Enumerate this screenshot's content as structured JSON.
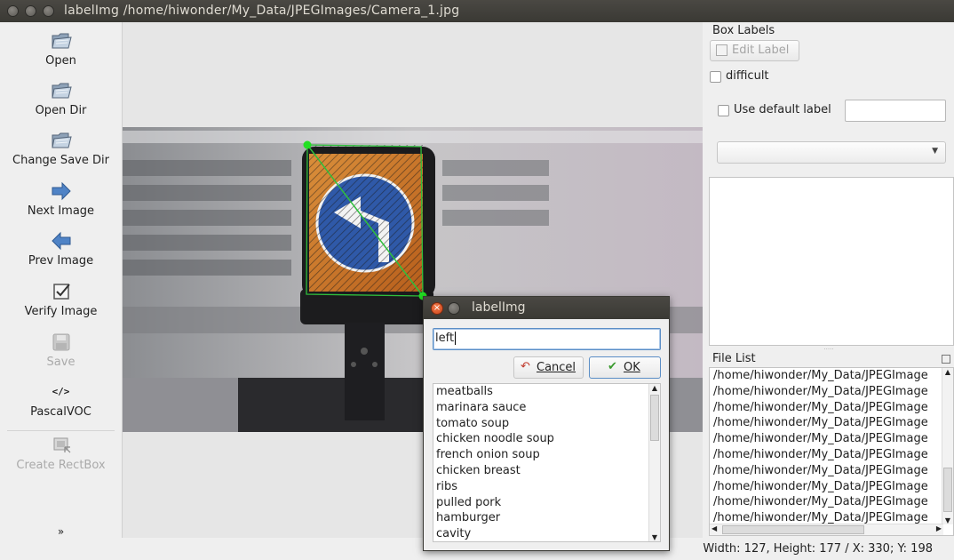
{
  "window": {
    "title": "labelImg /home/hiwonder/My_Data/JPEGImages/Camera_1.jpg"
  },
  "toolbar": {
    "items": [
      {
        "label": "Open",
        "icon": "folder-open-icon"
      },
      {
        "label": "Open Dir",
        "icon": "folder-open-icon"
      },
      {
        "label": "Change Save Dir",
        "icon": "folder-open-icon"
      },
      {
        "label": "Next Image",
        "icon": "arrow-right-icon"
      },
      {
        "label": "Prev Image",
        "icon": "arrow-left-icon"
      },
      {
        "label": "Verify Image",
        "icon": "checkbox-icon"
      },
      {
        "label": "Save",
        "icon": "save-icon",
        "disabled": true
      },
      {
        "label": "PascalVOC",
        "icon": "code-tags-icon"
      },
      {
        "label": "Create RectBox",
        "icon": "rect-box-icon",
        "disabled": true
      }
    ],
    "more_icon": "double-chevron-down-icon"
  },
  "dock": {
    "box_labels_title": "Box Labels",
    "edit_label": "Edit Label",
    "difficult_label": "difficult",
    "use_default_label": "Use default label",
    "default_label_value": "",
    "combo_value": "",
    "file_list_title": "File List",
    "files": [
      "/home/hiwonder/My_Data/JPEGImage",
      "/home/hiwonder/My_Data/JPEGImage",
      "/home/hiwonder/My_Data/JPEGImage",
      "/home/hiwonder/My_Data/JPEGImage",
      "/home/hiwonder/My_Data/JPEGImage",
      "/home/hiwonder/My_Data/JPEGImage",
      "/home/hiwonder/My_Data/JPEGImage",
      "/home/hiwonder/My_Data/JPEGImage",
      "/home/hiwonder/My_Data/JPEGImage",
      "/home/hiwonder/My_Data/JPEGImage"
    ]
  },
  "status": {
    "text": "Width: 127, Height: 177 / X: 330; Y: 198"
  },
  "dialog": {
    "title": "labelImg",
    "input_value": "left",
    "cancel_label": "Cancel",
    "ok_label": "OK",
    "labels": [
      "meatballs",
      "marinara sauce",
      "tomato soup",
      "chicken noodle soup",
      "french onion soup",
      "chicken breast",
      "ribs",
      "pulled pork",
      "hamburger",
      "cavity"
    ]
  },
  "colors": {
    "bbox_line": "#2fbf3c",
    "bbox_point": "#22e022",
    "sign_blue": "#2f59a8",
    "titlebar": "#3c3b37",
    "ok_border": "#5b8ec6"
  }
}
